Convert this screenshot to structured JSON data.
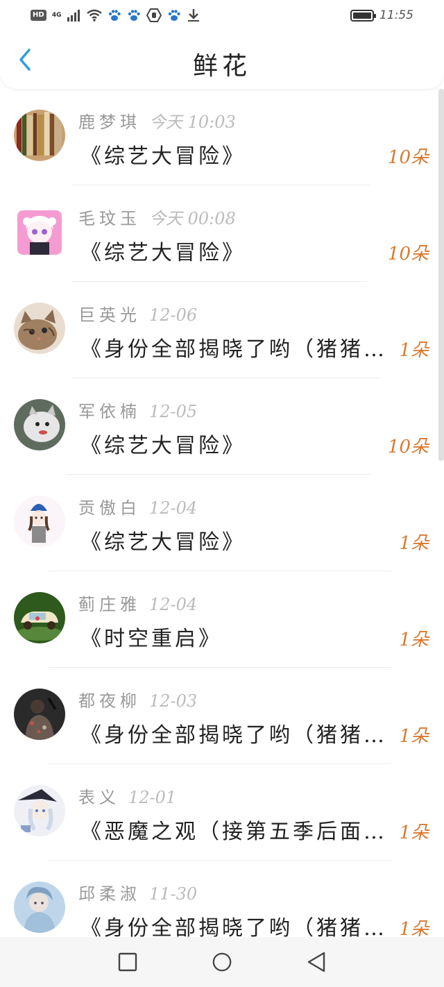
{
  "status_bar": {
    "hd": "HD",
    "network": "4G",
    "time": "11:55",
    "icons": [
      "hd-icon",
      "signal-icon",
      "wifi-icon",
      "paw-icon",
      "paw-icon",
      "hexagon-hand-icon",
      "paw-icon",
      "download-icon",
      "battery-icon"
    ]
  },
  "header": {
    "back_icon": "chevron-left-icon",
    "title": "鲜花"
  },
  "colors": {
    "accent": "#d9792f",
    "back": "#2f9cdb",
    "name": "#999999",
    "title": "#222222"
  },
  "items": [
    {
      "name": "鹿梦琪",
      "time": "今天 10:03",
      "show": "《综艺大冒险》",
      "count": "10朵",
      "avatar": "bookshelf"
    },
    {
      "name": "毛玟玉",
      "time": "今天 00:08",
      "show": "《综艺大冒险》",
      "count": "10朵",
      "avatar": "pink-anime-girl"
    },
    {
      "name": "巨英光",
      "time": "12-06",
      "show": "《身份全部揭晓了哟（猪猪…",
      "count": "1朵",
      "avatar": "kitten"
    },
    {
      "name": "军依楠",
      "time": "12-05",
      "show": "《综艺大冒险》",
      "count": "10朵",
      "avatar": "gray-cat"
    },
    {
      "name": "贡傲白",
      "time": "12-04",
      "show": "《综艺大冒险》",
      "count": "1朵",
      "avatar": "anime-girl-hat"
    },
    {
      "name": "蓟庄雅",
      "time": "12-04",
      "show": "《时空重启》",
      "count": "1朵",
      "avatar": "toy-car"
    },
    {
      "name": "都夜柳",
      "time": "12-03",
      "show": "《身份全部揭晓了哟（猪猪…",
      "count": "1朵",
      "avatar": "dark-person"
    },
    {
      "name": "表义",
      "time": "12-01",
      "show": "《恶魔之观（接第五季后面…",
      "count": "1朵",
      "avatar": "witch-anime"
    },
    {
      "name": "邱柔淑",
      "time": "11-30",
      "show": "《身份全部揭晓了哟（猪猪…",
      "count": "1朵",
      "avatar": "blue-girl"
    }
  ],
  "system_nav": {
    "icons": [
      "recent-apps-icon",
      "home-icon",
      "back-icon"
    ]
  }
}
